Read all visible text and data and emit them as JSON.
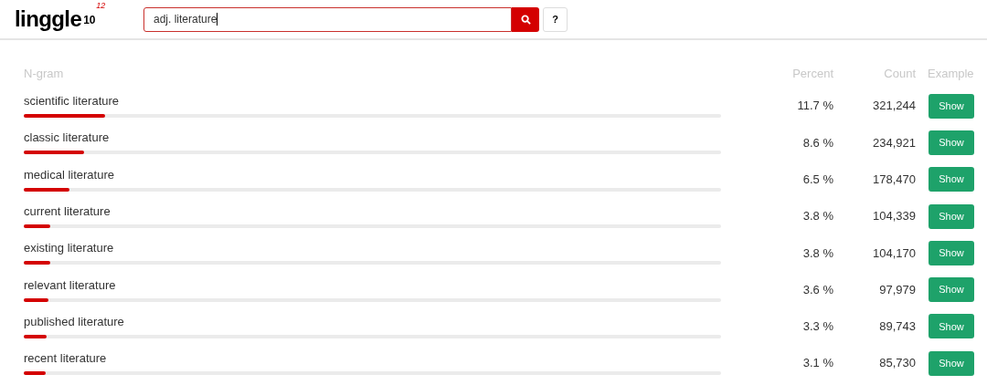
{
  "logo": {
    "name": "linggle",
    "power": "10",
    "exponent": "12"
  },
  "search": {
    "value": "adj. literature"
  },
  "help_button": "?",
  "table": {
    "columns": [
      "N-gram",
      "Percent",
      "Count",
      "Example"
    ],
    "rows": [
      {
        "ngram": "scientific literature",
        "level": 0.117,
        "percent": "11.7 %",
        "count": "321,244",
        "action": "Show"
      },
      {
        "ngram": "classic literature",
        "level": 0.086,
        "percent": "8.6 %",
        "count": "234,921",
        "action": "Show"
      },
      {
        "ngram": "medical literature",
        "level": 0.065,
        "percent": "6.5 %",
        "count": "178,470",
        "action": "Show"
      },
      {
        "ngram": "current literature",
        "level": 0.038,
        "percent": "3.8 %",
        "count": "104,339",
        "action": "Show"
      },
      {
        "ngram": "existing literature",
        "level": 0.038,
        "percent": "3.8 %",
        "count": "104,170",
        "action": "Show"
      },
      {
        "ngram": "relevant literature",
        "level": 0.036,
        "percent": "3.6 %",
        "count": "97,979",
        "action": "Show"
      },
      {
        "ngram": "published literature",
        "level": 0.033,
        "percent": "3.3 %",
        "count": "89,743",
        "action": "Show"
      },
      {
        "ngram": "recent literature",
        "level": 0.031,
        "percent": "3.1 %",
        "count": "85,730",
        "action": "Show"
      }
    ]
  }
}
